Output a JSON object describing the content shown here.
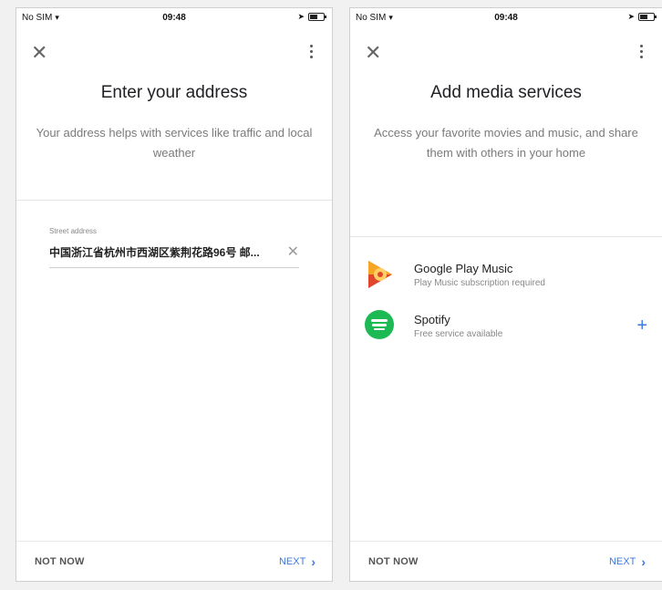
{
  "screens": [
    {
      "status": {
        "carrier": "No SIM",
        "time": "09:48"
      },
      "title": "Enter your address",
      "subtitle": "Your address helps with services like traffic and local weather",
      "address": {
        "label": "Street address",
        "value": "中国浙江省杭州市西湖区紫荆花路96号 邮..."
      },
      "footer": {
        "not_now": "NOT NOW",
        "next": "NEXT"
      }
    },
    {
      "status": {
        "carrier": "No SIM",
        "time": "09:48"
      },
      "title": "Add media services",
      "subtitle": "Access your favorite movies and music, and share them with others in your home",
      "services": [
        {
          "name": "Google Play Music",
          "desc": "Play Music subscription required",
          "icon": "google-play-music-icon"
        },
        {
          "name": "Spotify",
          "desc": "Free service available",
          "icon": "spotify-icon"
        }
      ],
      "footer": {
        "not_now": "NOT NOW",
        "next": "NEXT"
      }
    }
  ],
  "colors": {
    "accent": "#3b7be0",
    "spotify": "#1db954",
    "gpm_orange": "#f5a623",
    "gpm_red": "#e0452d"
  }
}
